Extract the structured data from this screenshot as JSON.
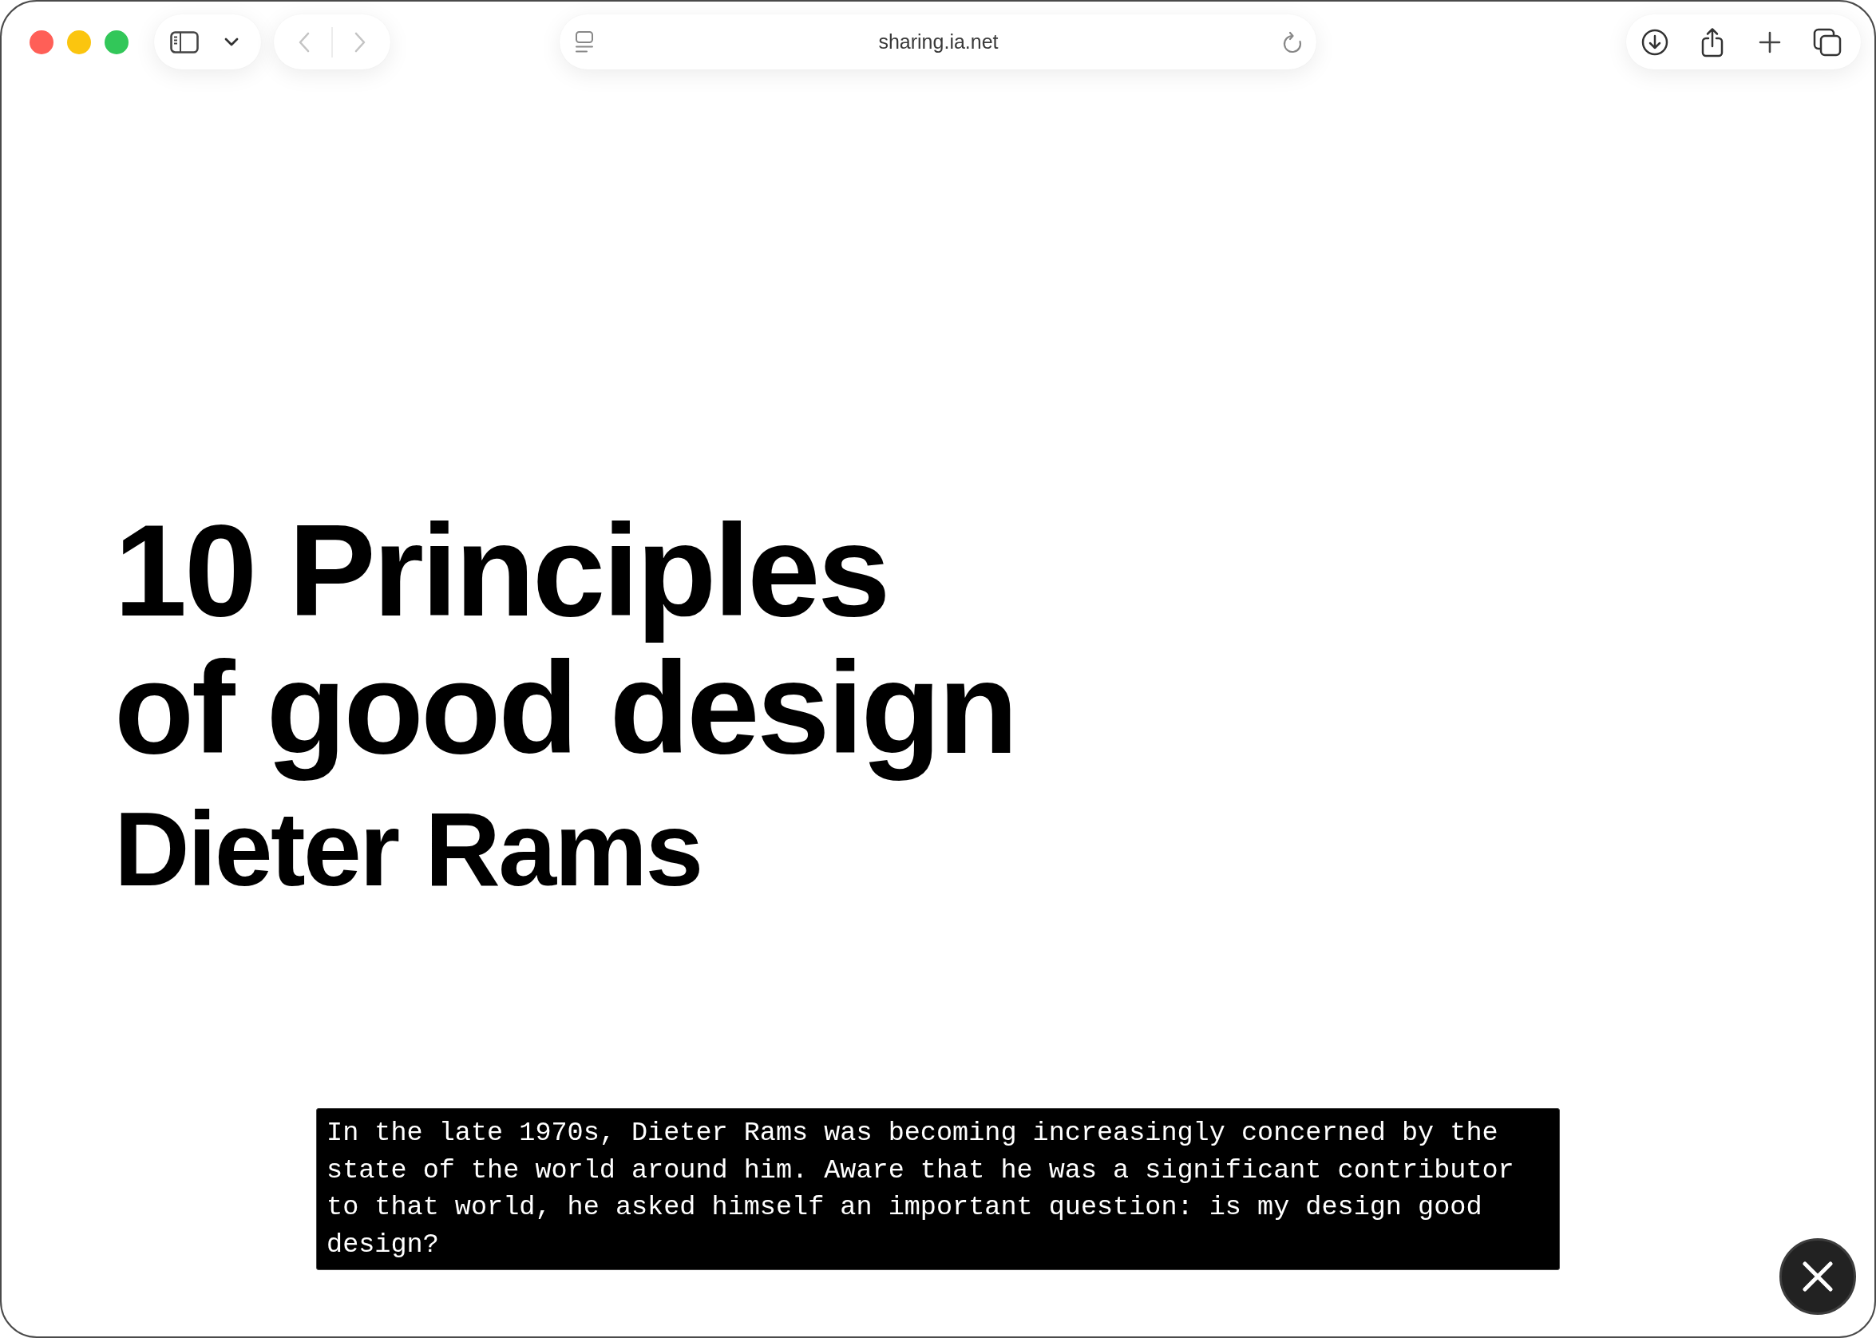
{
  "window": {
    "traffic_lights": [
      {
        "color": "#ff5f57"
      },
      {
        "color": "#fbc50f"
      },
      {
        "color": "#32c759"
      }
    ],
    "nav_buttons": [
      {
        "kind": "back",
        "disabled": true
      },
      {
        "kind": "forward",
        "disabled": true
      }
    ],
    "address_bar": {
      "url": "sharing.ia.net"
    }
  },
  "page": {
    "title": "10 Principles of good design",
    "author": "Dieter Rams",
    "caption": "In the late 1970s, Dieter Rams was becoming increasingly concerned by the state of the world around him. Aware that he was a significant contributor to that world, he asked himself an important question: is my design good design?"
  }
}
